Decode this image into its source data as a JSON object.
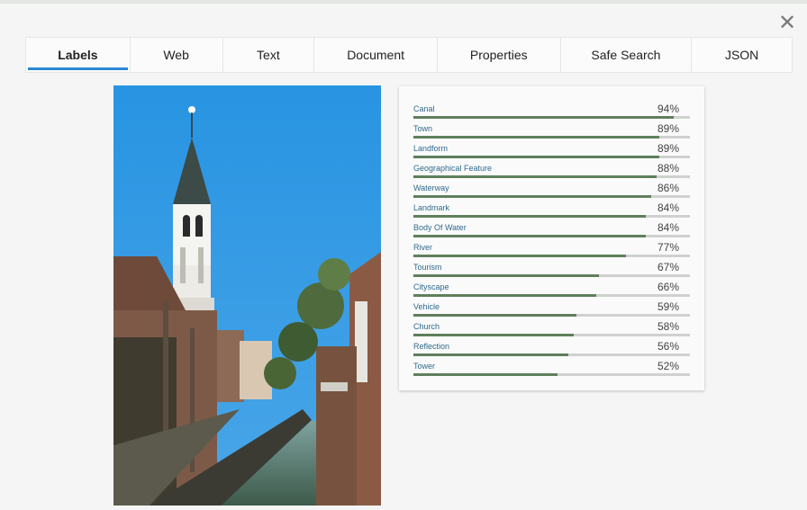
{
  "tabs": [
    {
      "label": "Labels",
      "active": true
    },
    {
      "label": "Web"
    },
    {
      "label": "Text"
    },
    {
      "label": "Document"
    },
    {
      "label": "Properties"
    },
    {
      "label": "Safe Search"
    },
    {
      "label": "JSON"
    }
  ],
  "close_icon": "close-icon",
  "labels": [
    {
      "name": "Canal",
      "percent": "94%",
      "score": 0.94
    },
    {
      "name": "Town",
      "percent": "89%",
      "score": 0.89
    },
    {
      "name": "Landform",
      "percent": "89%",
      "score": 0.89
    },
    {
      "name": "Geographical Feature",
      "percent": "88%",
      "score": 0.88
    },
    {
      "name": "Waterway",
      "percent": "86%",
      "score": 0.86
    },
    {
      "name": "Landmark",
      "percent": "84%",
      "score": 0.84
    },
    {
      "name": "Body Of Water",
      "percent": "84%",
      "score": 0.84
    },
    {
      "name": "River",
      "percent": "77%",
      "score": 0.77
    },
    {
      "name": "Tourism",
      "percent": "67%",
      "score": 0.67
    },
    {
      "name": "Cityscape",
      "percent": "66%",
      "score": 0.66
    },
    {
      "name": "Vehicle",
      "percent": "59%",
      "score": 0.59
    },
    {
      "name": "Church",
      "percent": "58%",
      "score": 0.58
    },
    {
      "name": "Reflection",
      "percent": "56%",
      "score": 0.56
    },
    {
      "name": "Tower",
      "percent": "52%",
      "score": 0.52
    }
  ],
  "colors": {
    "accent": "#2a88d4",
    "bar_fill": "#5f7f5b",
    "bar_track": "#cfd1cf",
    "label_text": "#2e6a8e"
  }
}
